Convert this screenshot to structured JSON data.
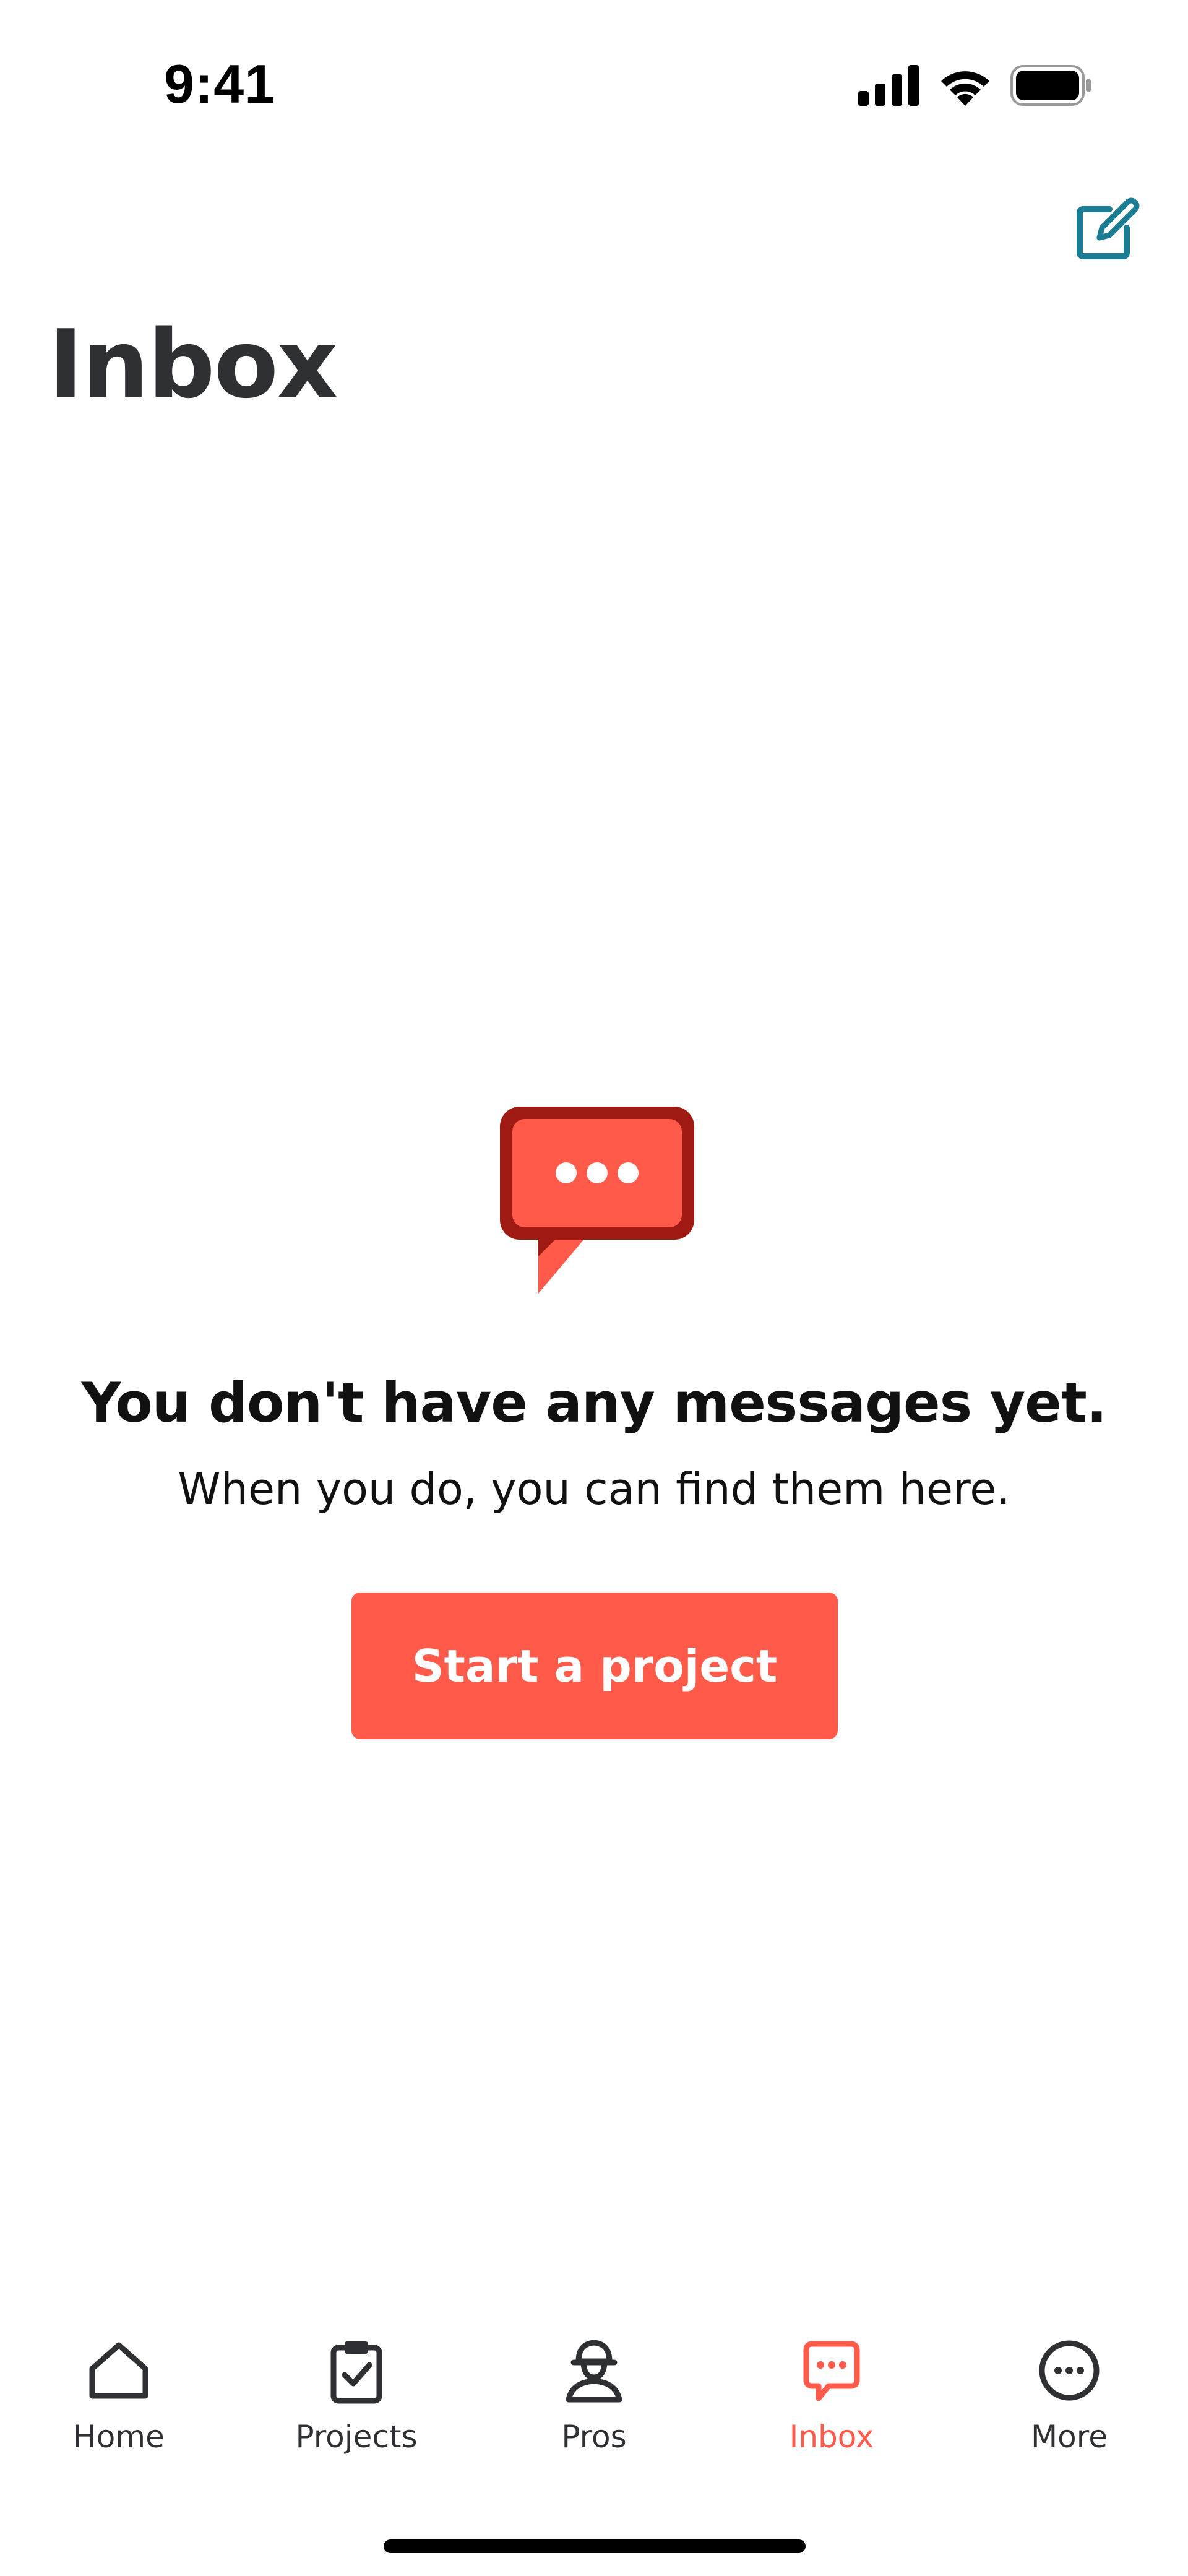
{
  "status_bar": {
    "time": "9:41"
  },
  "header": {
    "title": "Inbox",
    "compose_icon": "compose-icon"
  },
  "empty_state": {
    "icon": "chat-bubble-icon",
    "title": "You don't have any messages yet.",
    "subtitle": "When you do, you can find them here.",
    "cta_label": "Start a project"
  },
  "tabbar": {
    "tabs": [
      {
        "label": "Home",
        "icon": "home-icon",
        "active": false
      },
      {
        "label": "Projects",
        "icon": "clipboard-check-icon",
        "active": false
      },
      {
        "label": "Pros",
        "icon": "pro-person-icon",
        "active": false
      },
      {
        "label": "Inbox",
        "icon": "chat-bubble-icon",
        "active": true
      },
      {
        "label": "More",
        "icon": "more-circle-icon",
        "active": false
      }
    ]
  },
  "colors": {
    "accent": "#ff5a4a",
    "accent_dark": "#9e1a12",
    "compose": "#1a7d94",
    "text": "#2f3033"
  }
}
